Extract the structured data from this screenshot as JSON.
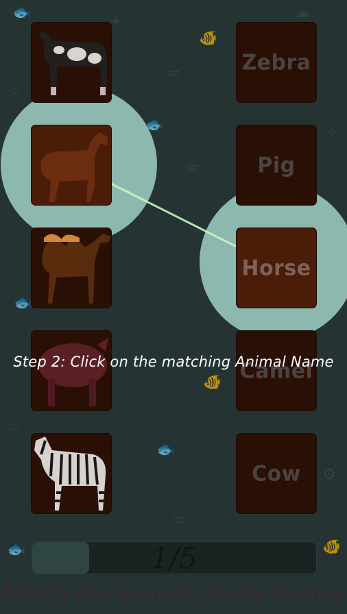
{
  "game": {
    "title": "Match the Animals to the Names",
    "instruction": "Step 2: Click on the matching Animal Name",
    "progress": {
      "text": "1/5",
      "fraction": 0.2
    }
  },
  "animals": [
    {
      "name": "cow",
      "icon": "cow-icon"
    },
    {
      "name": "horse",
      "icon": "horse-icon"
    },
    {
      "name": "camel",
      "icon": "camel-icon"
    },
    {
      "name": "pig",
      "icon": "pig-icon"
    },
    {
      "name": "zebra",
      "icon": "zebra-icon"
    }
  ],
  "names": [
    "Zebra",
    "Pig",
    "Horse",
    "Camel",
    "Cow"
  ],
  "highlight": {
    "animal": "horse",
    "name": "Horse",
    "line_color": "#c9f5c0",
    "spot_color": "#aadfd4"
  }
}
